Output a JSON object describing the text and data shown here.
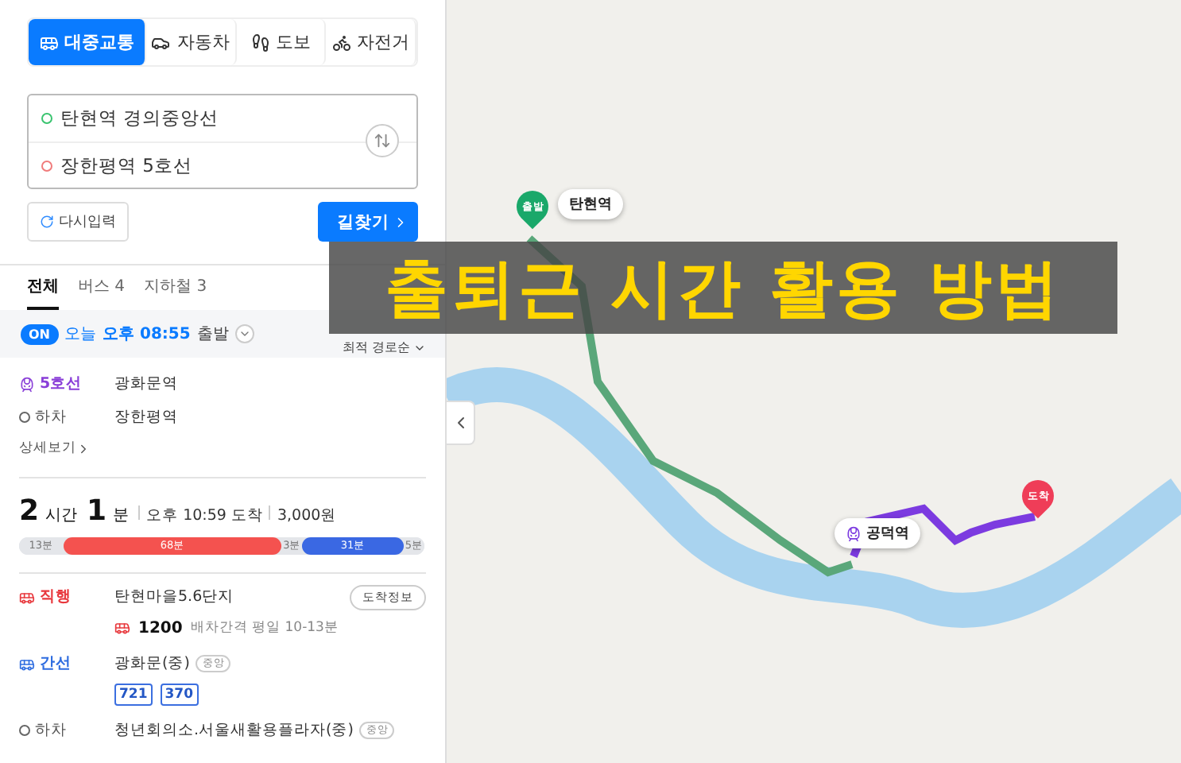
{
  "mode_tabs": [
    {
      "kind": "transit",
      "label": "대중교통",
      "selected": true
    },
    {
      "kind": "car",
      "label": "자동차",
      "selected": false
    },
    {
      "kind": "walk",
      "label": "도보",
      "selected": false
    },
    {
      "kind": "bike",
      "label": "자전거",
      "selected": false
    }
  ],
  "route_input": {
    "origin": "탄현역 경의중앙선",
    "destination": "장한평역 5호선"
  },
  "reset_button": "다시입력",
  "search_button": "길찾기",
  "filter_tabs": [
    {
      "label": "전체",
      "selected": true
    },
    {
      "label": "버스 4",
      "selected": false
    },
    {
      "label": "지하철 3",
      "selected": false
    }
  ],
  "departure": {
    "toggle": "ON",
    "on": true,
    "prefix": "오늘",
    "time": "오후 08:55",
    "suffix": "출발",
    "sort": "최적 경로순"
  },
  "route_prev": {
    "steps": [
      {
        "kind": "subway",
        "line": "5호선",
        "stop": "광화문역"
      },
      {
        "kind": "alight",
        "line": "하차",
        "stop": "장한평역"
      }
    ],
    "more": "상세보기"
  },
  "route": {
    "hours": "2",
    "hours_unit": "시간",
    "minutes": "1",
    "minutes_unit": "분",
    "arrival": "오후 10:59 도착",
    "fare": "3,000원",
    "segments": [
      {
        "kind": "walk",
        "label": "13분"
      },
      {
        "kind": "red_bus",
        "label": "68분"
      },
      {
        "kind": "walk",
        "label": "3분"
      },
      {
        "kind": "blue_bus",
        "label": "31분"
      },
      {
        "kind": "walk",
        "label": "5분"
      }
    ],
    "steps": [
      {
        "kind": "red_bus",
        "line": "직행",
        "stop": "탄현마을5.6단지",
        "button": "도착정보",
        "bus_no": "1200",
        "interval": "배차간격 평일 10-13분"
      },
      {
        "kind": "blue_bus",
        "line": "간선",
        "stop": "광화문(중)",
        "badge": "중앙",
        "buses": [
          "721",
          "370"
        ]
      },
      {
        "kind": "alight",
        "line": "하차",
        "stop": "청년회의소.서울새활용플라자(중)",
        "badge": "중앙"
      }
    ]
  },
  "map": {
    "start_pin": "출발",
    "start_label": "탄현역",
    "transfer_label": "공덕역",
    "end_pin": "도착"
  },
  "banner": "출퇴근 시간 활용 방법"
}
